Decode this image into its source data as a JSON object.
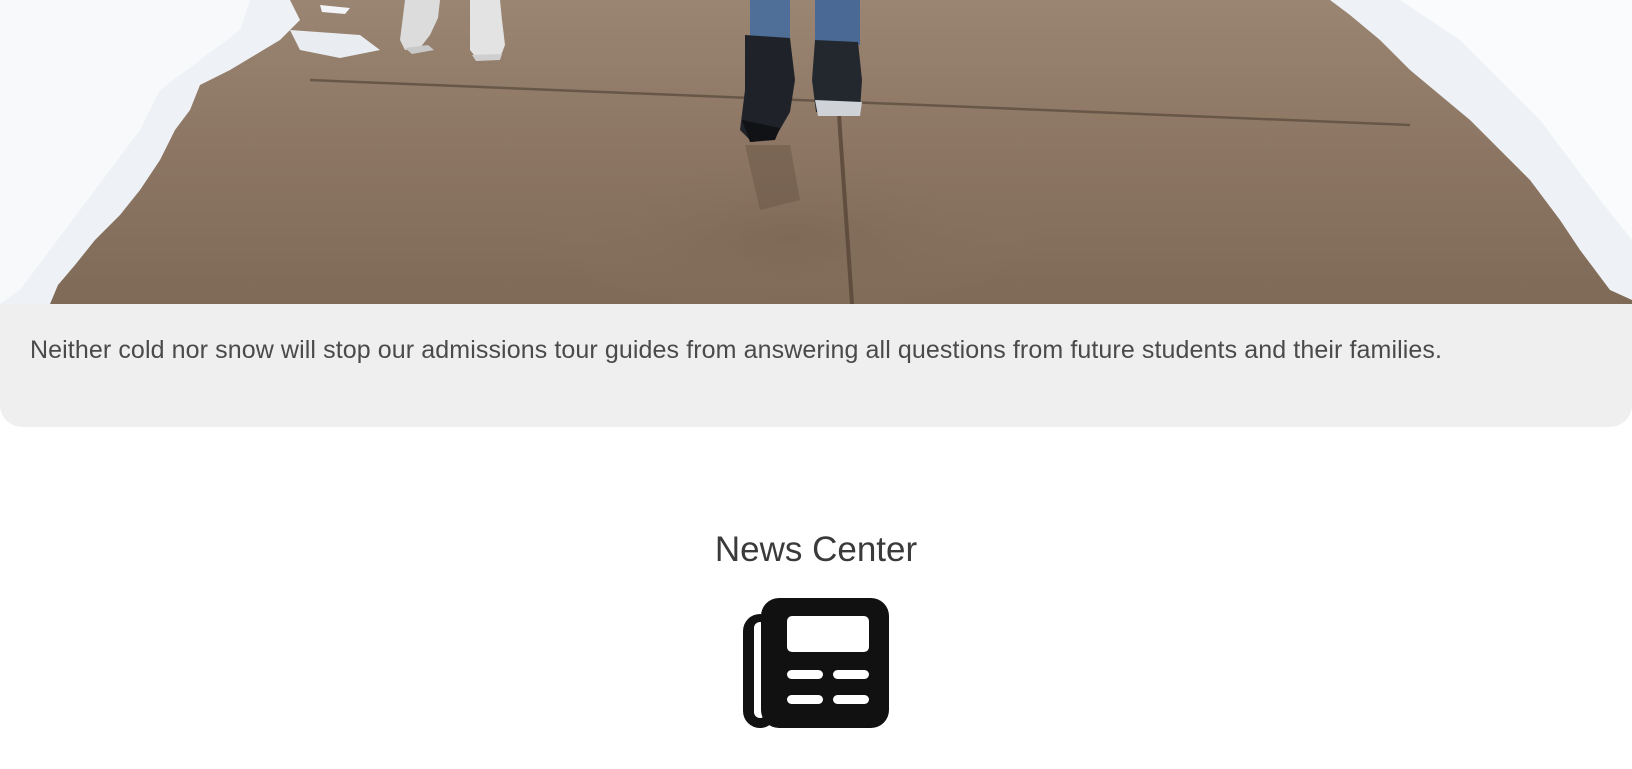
{
  "hero": {
    "image_name": "snowy-sidewalk-tour-photo",
    "caption": "Neither cold nor snow will stop our admissions tour guides from answering all questions from future students and their families."
  },
  "news": {
    "title": "News Center",
    "icon": "newspaper-icon"
  }
}
